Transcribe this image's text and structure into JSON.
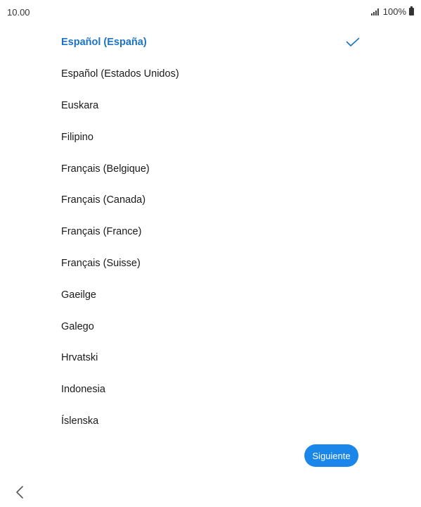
{
  "status_bar": {
    "time": "10.00",
    "battery": "100%",
    "icons": [
      "signal-icon",
      "battery-icon"
    ]
  },
  "languages": {
    "selected_index": 0,
    "accent_color": "#1a73c8",
    "items": [
      {
        "label": "Español (España)",
        "selected": true
      },
      {
        "label": "Español (Estados Unidos)",
        "selected": false
      },
      {
        "label": "Euskara",
        "selected": false
      },
      {
        "label": "Filipino",
        "selected": false
      },
      {
        "label": "Français (Belgique)",
        "selected": false
      },
      {
        "label": "Français (Canada)",
        "selected": false
      },
      {
        "label": "Français (France)",
        "selected": false
      },
      {
        "label": "Français (Suisse)",
        "selected": false
      },
      {
        "label": "Gaeilge",
        "selected": false
      },
      {
        "label": "Galego",
        "selected": false
      },
      {
        "label": "Hrvatski",
        "selected": false
      },
      {
        "label": "Indonesia",
        "selected": false
      },
      {
        "label": "Íslenska",
        "selected": false
      }
    ]
  },
  "footer": {
    "next_label": "Siguiente",
    "next_color": "#1a86ea",
    "back_icon": "chevron-left-icon"
  }
}
